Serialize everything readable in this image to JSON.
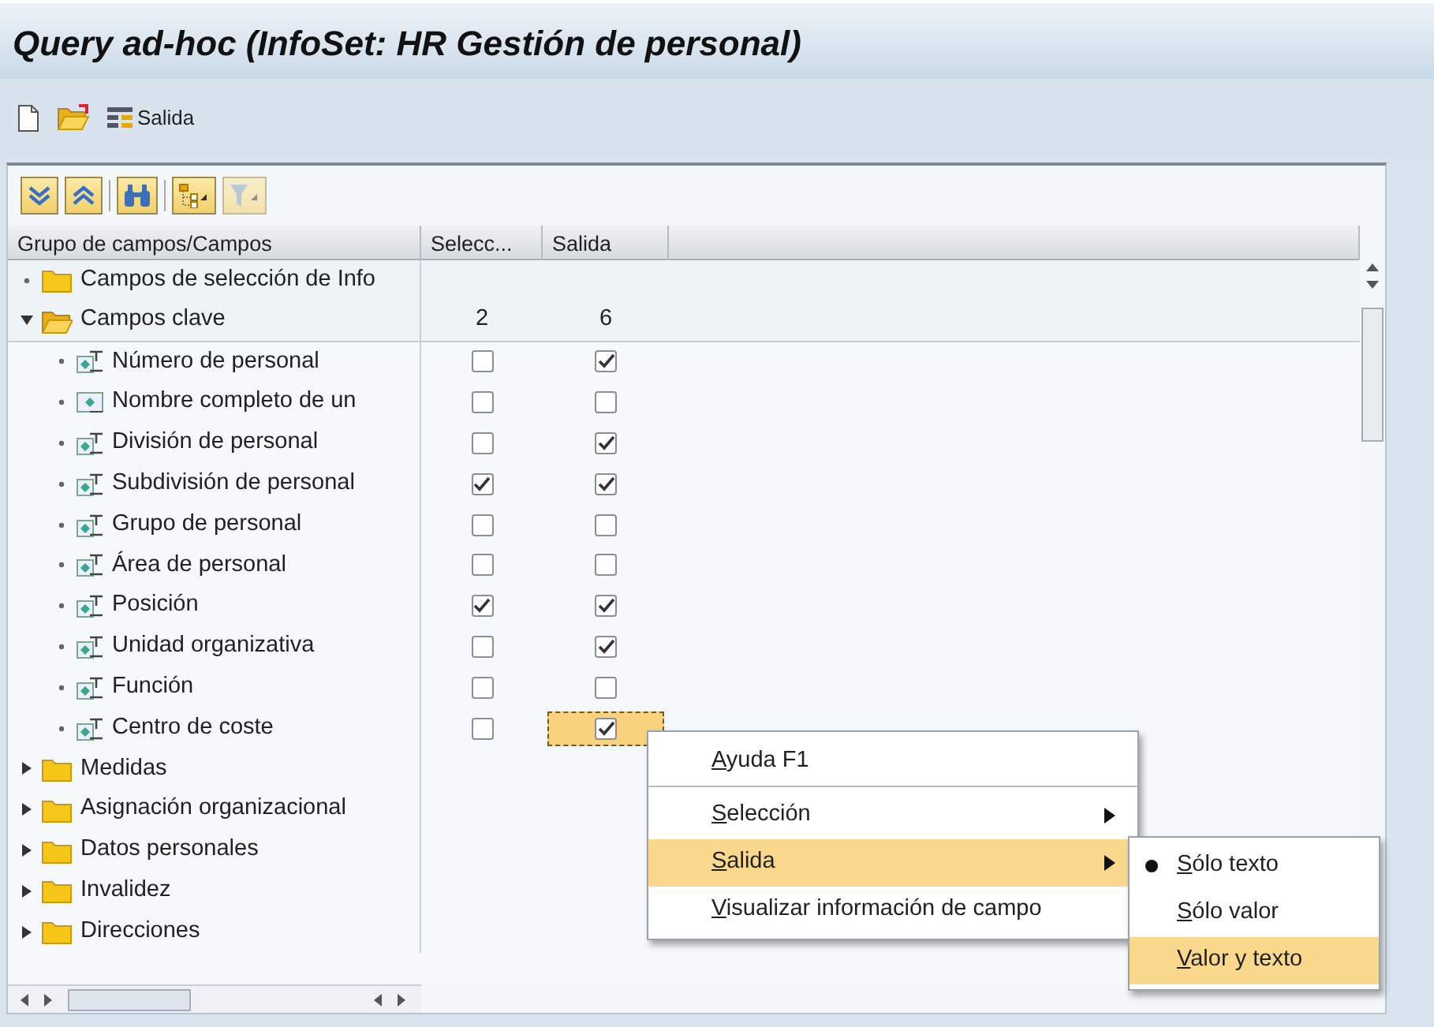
{
  "window": {
    "title": "Query ad-hoc (InfoSet: HR Gestión de personal)"
  },
  "toolbar": [
    {
      "kind": "new"
    },
    {
      "kind": "open"
    },
    {
      "kind": "output",
      "label": "Salida"
    }
  ],
  "tree_toolbar": [
    {
      "kind": "expand",
      "disabled": false
    },
    {
      "kind": "collapse",
      "disabled": false
    },
    {
      "kind": "find",
      "disabled": false
    },
    {
      "kind": "layout",
      "disabled": false
    },
    {
      "kind": "filter",
      "disabled": true
    }
  ],
  "columns": [
    "Grupo de campos/Campos",
    "Selecc...",
    "Salida"
  ],
  "tree": [
    {
      "kind": "group",
      "label": "Campos de selección de Info"
    },
    {
      "kind": "folder",
      "label": "Campos clave",
      "expanded": true,
      "selection_count": "2",
      "output_count": "6",
      "children": [
        {
          "kind": "text_field",
          "label": "Número de personal",
          "selection": false,
          "output": true,
          "focused": false
        },
        {
          "kind": "field",
          "label": "Nombre completo de un",
          "selection": false,
          "output": false,
          "focused": false
        },
        {
          "kind": "text_field",
          "label": "División de personal",
          "selection": false,
          "output": true,
          "focused": false
        },
        {
          "kind": "text_field",
          "label": "Subdivisión de personal",
          "selection": true,
          "output": true,
          "focused": false
        },
        {
          "kind": "text_field",
          "label": "Grupo de personal",
          "selection": false,
          "output": false,
          "focused": false
        },
        {
          "kind": "text_field",
          "label": "Área de personal",
          "selection": false,
          "output": false,
          "focused": false
        },
        {
          "kind": "text_field",
          "label": "Posición",
          "selection": true,
          "output": true,
          "focused": false
        },
        {
          "kind": "text_field",
          "label": "Unidad organizativa",
          "selection": false,
          "output": true,
          "focused": false
        },
        {
          "kind": "text_field",
          "label": "Función",
          "selection": false,
          "output": false,
          "focused": false
        },
        {
          "kind": "text_field",
          "label": "Centro de coste",
          "selection": false,
          "output": true,
          "focused": true
        }
      ]
    },
    {
      "kind": "folder",
      "label": "Medidas",
      "expanded": false
    },
    {
      "kind": "folder",
      "label": "Asignación organizacional",
      "expanded": false
    },
    {
      "kind": "folder",
      "label": "Datos personales",
      "expanded": false
    },
    {
      "kind": "folder",
      "label": "Invalidez",
      "expanded": false
    },
    {
      "kind": "folder",
      "label": "Direcciones",
      "expanded": false
    }
  ],
  "context_menu": [
    {
      "label": "Ayuda F1",
      "submenu": false,
      "highlighted": false,
      "separator_after": true
    },
    {
      "label": "Selección",
      "submenu": true,
      "highlighted": false,
      "separator_after": false
    },
    {
      "label": "Salida",
      "submenu": true,
      "highlighted": true,
      "separator_after": false
    },
    {
      "label": "Visualizar información de campo",
      "submenu": false,
      "highlighted": false,
      "separator_after": false
    }
  ],
  "submenu": [
    {
      "label": "Sólo texto",
      "chosen": true,
      "highlighted": false
    },
    {
      "label": "Sólo valor",
      "chosen": false,
      "highlighted": false
    },
    {
      "label": "Valor y texto",
      "chosen": false,
      "highlighted": true
    }
  ]
}
